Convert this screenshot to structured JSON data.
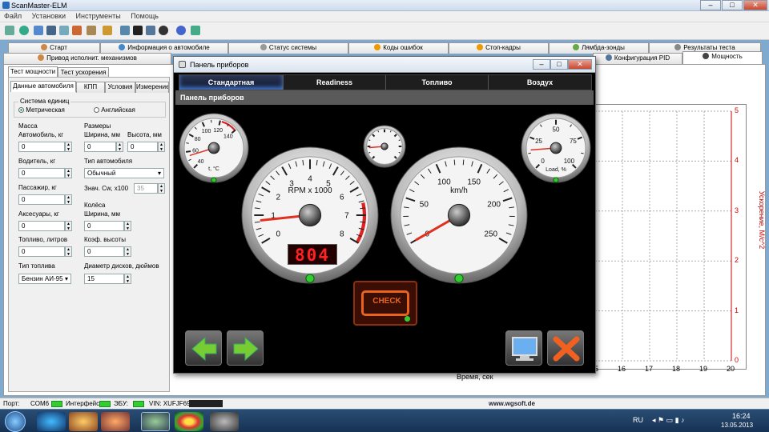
{
  "app": {
    "title": "ScanMaster-ELM",
    "minimize": "–",
    "maximize": "□",
    "close": "✕"
  },
  "menu": [
    "Файл",
    "Установки",
    "Инструменты",
    "Помощь"
  ],
  "tabs_row1": [
    "Старт",
    "Информация о автомобиле",
    "Статус системы",
    "Коды ошибок",
    "Стоп-кадры",
    "Лямбда-зонды",
    "Результаты теста"
  ],
  "tabs_row2": [
    "Привод исполнит. механизмов",
    "Конфигурация PID",
    "Мощность"
  ],
  "left": {
    "tabs": [
      "Тест мощности",
      "Тест ускорения"
    ],
    "subtabs": [
      "Данные автомобиля",
      "КПП",
      "Условия",
      "Измерение"
    ],
    "units_label": "Система единиц",
    "metric": "Метрическая",
    "english": "Английская",
    "mass": "Масса",
    "car_kg": "Автомобиль, кг",
    "car_kg_val": "0",
    "driver_kg": "Водитель, кг",
    "driver_kg_val": "0",
    "passenger_kg": "Пассажир, кг",
    "passenger_kg_val": "0",
    "accessories_kg": "Аксесуары, кг",
    "accessories_kg_val": "0",
    "fuel_l": "Топливо, литров",
    "fuel_l_val": "0",
    "fuel_type": "Тип топлива",
    "fuel_type_val": "Бензин АИ-95",
    "dims": "Размеры",
    "width_mm": "Ширина, мм",
    "width_mm_val": "0",
    "height_mm": "Высота, мм",
    "height_mm_val": "0",
    "car_type": "Тип автомобиля",
    "car_type_val": "Обычный",
    "cw_label": "Знач. Cw, x100",
    "cw_val": "35",
    "wheels": "Колёса",
    "wheel_width": "Ширина, мм",
    "wheel_width_val": "0",
    "height_coef": "Коэф. высоты",
    "height_coef_val": "0",
    "rim_diam": "Диаметр дисков, дюймов",
    "rim_diam_val": "15"
  },
  "chart": {
    "ylabel": "Ускорение, М/с^2",
    "xlabel": "Время, сек",
    "yticks": [
      "0",
      "1",
      "2",
      "3",
      "4",
      "5"
    ],
    "xticks": [
      "15",
      "16",
      "17",
      "18",
      "19",
      "20"
    ]
  },
  "dash": {
    "title": "Панель приборов",
    "tabs": [
      "Стандартная",
      "Readiness",
      "Топливо",
      "Воздух"
    ],
    "subtitle": "Панель приборов",
    "temp": {
      "label": "t, °C",
      "ticks": [
        "40",
        "60",
        "80",
        "100",
        "120",
        "140"
      ],
      "value": 55
    },
    "rpm": {
      "label": "RPM x 1000",
      "ticks": [
        "0",
        "1",
        "2",
        "3",
        "4",
        "5",
        "6",
        "7",
        "8"
      ],
      "value": 0.8,
      "display": "804"
    },
    "speed": {
      "label": "km/h",
      "ticks": [
        "0",
        "50",
        "100",
        "150",
        "200",
        "250"
      ],
      "value": 0
    },
    "load": {
      "label": "Load, %",
      "ticks": [
        "0",
        "25",
        "50",
        "75",
        "100"
      ],
      "value": 20
    },
    "check": "CHECK"
  },
  "status": {
    "port_label": "Порт:",
    "port_val": "COM6",
    "iface_label": "Интерфейс:",
    "ecu_label": "ЭБУ:",
    "vin": "VIN: XUFJF695",
    "url": "www.wgsoft.de"
  },
  "taskbar": {
    "lang": "RU",
    "time": "16:24",
    "date": "13.05.2013"
  },
  "colors": {
    "needle": "#e03020",
    "led_green": "#3c3",
    "check_orange": "#e8641e"
  }
}
